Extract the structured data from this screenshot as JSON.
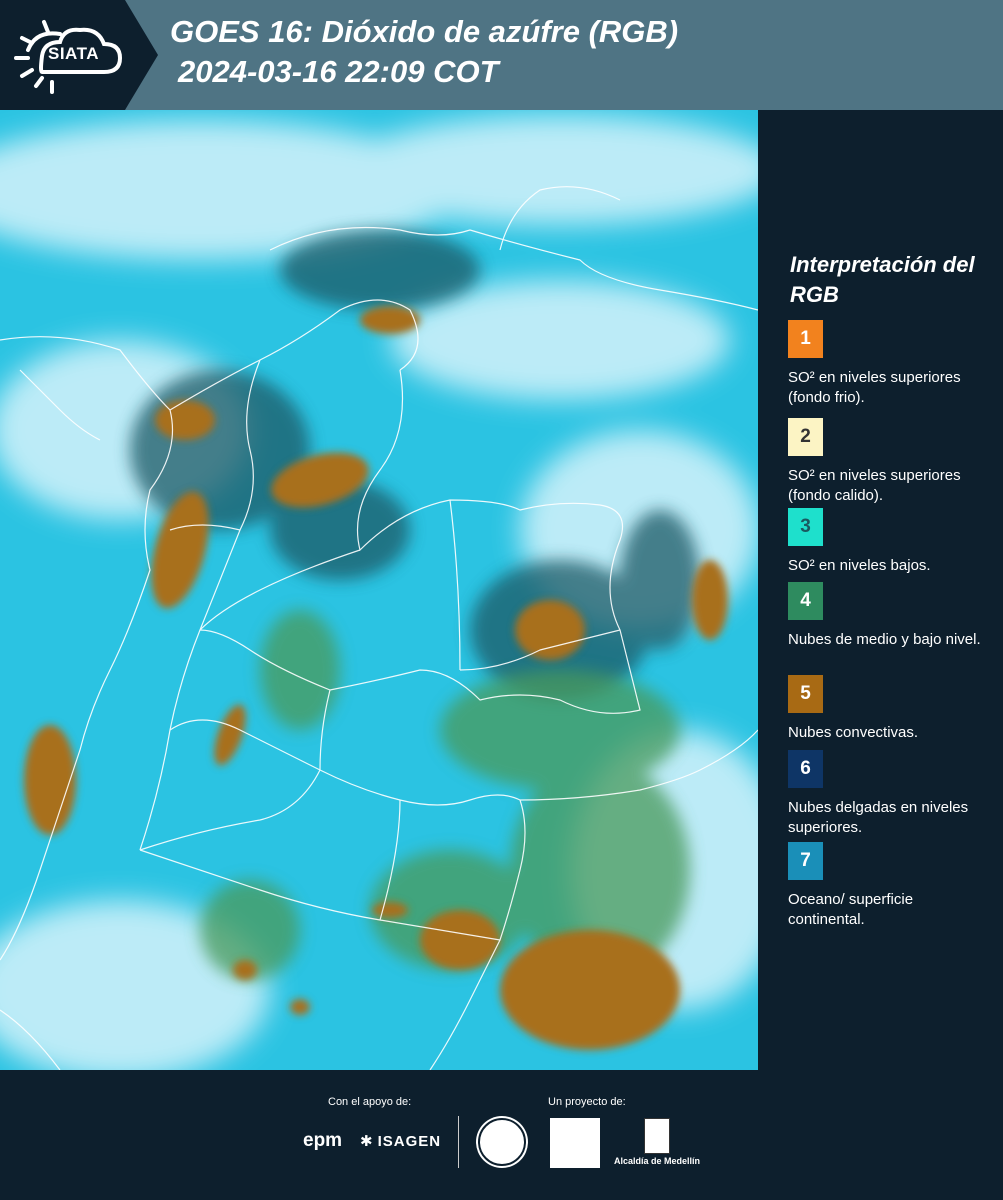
{
  "header": {
    "logo_text": "SIATA",
    "title_line1": "GOES 16: Dióxido de azúfre (RGB)",
    "title_line2": "2024-03-16 22:09 COT",
    "bg_color": "#4f7484"
  },
  "map": {
    "icon": "satellite-rgb-map",
    "colors": {
      "ocean": "#2bc3e2",
      "clouds": "#c8eef8",
      "convective": "#a86f1c",
      "green": "#3f8a5a",
      "dark": "#1d4a5a"
    }
  },
  "legend": {
    "title": "Interpretación del RGB",
    "items": [
      {
        "num": "1",
        "label": "SO² en niveles superiores (fondo frio).",
        "color": "#f2821e",
        "text_color": "#ffffff"
      },
      {
        "num": "2",
        "label": "SO² en niveles superiores (fondo calido).",
        "color": "#fcf4c4",
        "text_color": "#333333"
      },
      {
        "num": "3",
        "label": "SO² en niveles bajos.",
        "color": "#1ee0cc",
        "text_color": "#1a5a60"
      },
      {
        "num": "4",
        "label": "Nubes de medio y bajo nivel.",
        "color": "#2e8b5f",
        "text_color": "#ffffff"
      },
      {
        "num": "5",
        "label": "Nubes convectivas.",
        "color": "#a86a14",
        "text_color": "#ffffff"
      },
      {
        "num": "6",
        "label": "Nubes delgadas en niveles superiores.",
        "color": "#0e3566",
        "text_color": "#ffffff"
      },
      {
        "num": "7",
        "label": "Oceano/ superficie continental.",
        "color": "#1a8fb8",
        "text_color": "#ffffff"
      }
    ]
  },
  "footer": {
    "support_label": "Con el apoyo de:",
    "project_label": "Un proyecto de:",
    "sponsor1": "epm",
    "sponsor2": "ISAGEN",
    "alcaldia": "Alcaldía de Medellín"
  }
}
